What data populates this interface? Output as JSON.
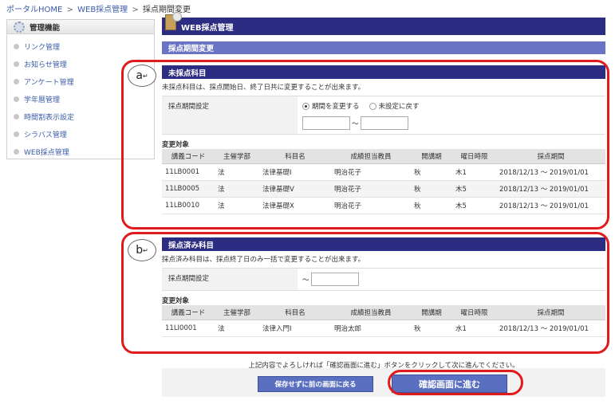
{
  "breadcrumb": {
    "home": "ポータルHOME",
    "parent": "WEB採点管理",
    "current": "採点期間変更",
    "sep": ">"
  },
  "sidebar": {
    "title": "管理機能",
    "items": [
      {
        "label": "リンク管理"
      },
      {
        "label": "お知らせ管理"
      },
      {
        "label": "アンケート管理"
      },
      {
        "label": "学年暦管理"
      },
      {
        "label": "時間割表示設定"
      },
      {
        "label": "シラバス管理"
      },
      {
        "label": "WEB採点管理"
      }
    ]
  },
  "page": {
    "title": "WEB採点管理",
    "subtitle": "採点期間変更"
  },
  "columns": [
    "講義コード",
    "主催学部",
    "科目名",
    "成績担当教員",
    "開講期",
    "曜日時限",
    "採点期間"
  ],
  "unscored": {
    "marker": "a",
    "marker_mark": "↵",
    "heading": "未採点科目",
    "description": "未採点科目は、採点開始日、終了日共に変更することが出来ます。",
    "setting_label": "採点期間設定",
    "radio_change": "期間を変更する",
    "radio_reset": "未設定に戻す",
    "tilde": "～",
    "target_label": "変更対象",
    "rows": [
      [
        "11LB0001",
        "法",
        "法律基礎Ⅰ",
        "明治花子",
        "秋",
        "木1",
        "2018/12/13 ～ 2019/01/01"
      ],
      [
        "11LB0005",
        "法",
        "法律基礎Ⅴ",
        "明治花子",
        "秋",
        "木5",
        "2018/12/13 ～ 2019/01/01"
      ],
      [
        "11LB0010",
        "法",
        "法律基礎Ⅹ",
        "明治花子",
        "秋",
        "木5",
        "2018/12/13 ～ 2019/01/01"
      ]
    ]
  },
  "scored": {
    "marker": "b",
    "marker_mark": "↵",
    "heading": "採点済み科目",
    "description": "採点済み科目は、採点終了日のみ一括で変更することが出来ます。",
    "setting_label": "採点期間設定",
    "tilde": "～",
    "target_label": "変更対象",
    "rows": [
      [
        "11LI0001",
        "法",
        "法律入門Ⅰ",
        "明治太郎",
        "秋",
        "水1",
        "2018/12/13 ～ 2019/01/01"
      ]
    ]
  },
  "footer": {
    "note": "上記内容でよろしければ「確認画面に進む」ボタンをクリックして次に進んでください。",
    "back_button": "保存せずに前の画面に戻る",
    "next_button": "確認画面に進む"
  },
  "colors": {
    "accent": "#2c2c82",
    "highlight": "#e01b1b"
  }
}
